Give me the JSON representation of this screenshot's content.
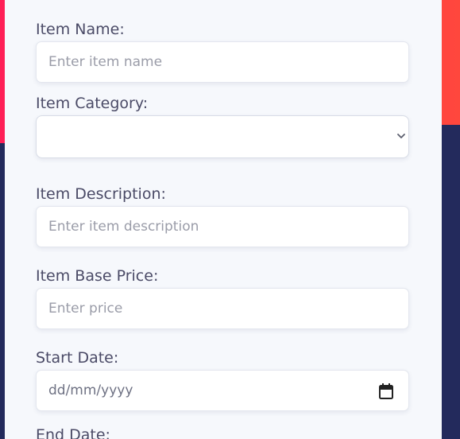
{
  "form": {
    "item_name": {
      "label": "Item Name:",
      "placeholder": "Enter item name",
      "value": ""
    },
    "item_category": {
      "label": "Item Category:",
      "selected": ""
    },
    "item_description": {
      "label": "Item Description:",
      "placeholder": "Enter item description",
      "value": ""
    },
    "item_base_price": {
      "label": "Item Base Price:",
      "placeholder": "Enter price",
      "value": ""
    },
    "start_date": {
      "label": "Start Date:",
      "placeholder": "dd/mm/yyyy"
    },
    "end_date": {
      "label": "End Date:"
    }
  },
  "colors": {
    "accent_red": "#ff1f57",
    "accent_orange": "#ff473d",
    "navy_background": "#232a5c",
    "card_background": "#f6f8fc",
    "label_text": "#4a4a66"
  },
  "icons": {
    "select_arrow": "chevron-down-icon",
    "date_picker": "calendar-icon"
  }
}
